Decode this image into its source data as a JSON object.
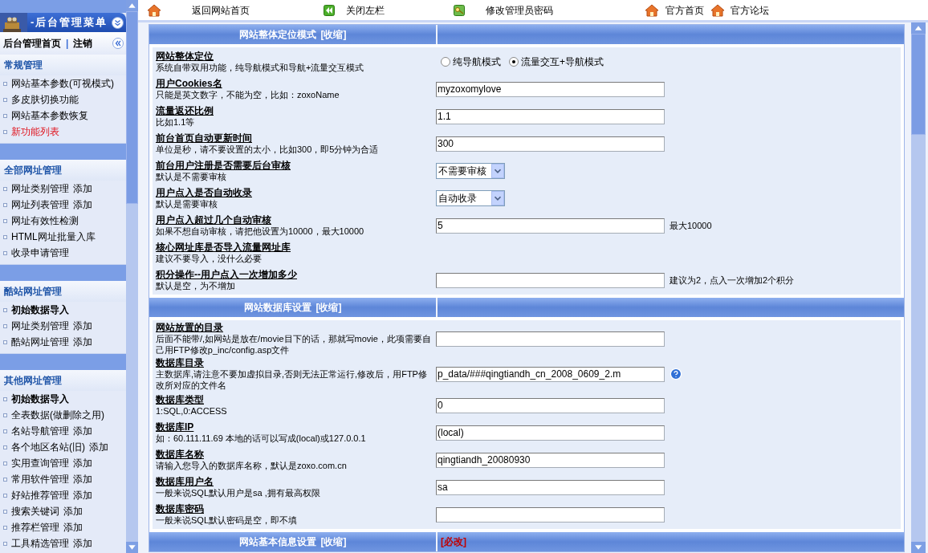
{
  "sidebar": {
    "title": "-后台管理菜单",
    "home": "后台管理首页",
    "separator": "|",
    "logout": "注销",
    "groups": [
      {
        "title": "常规管理",
        "items": [
          {
            "label": "网站基本参数(可视模式)",
            "kind": "plain"
          },
          {
            "label": "多皮肤切换功能",
            "kind": "plain"
          },
          {
            "label": "网站基本参数恢复",
            "kind": "plain"
          },
          {
            "label": "新功能列表",
            "kind": "new"
          }
        ]
      },
      {
        "title": "全部网址管理",
        "items": [
          {
            "label": "网址类别管理",
            "action": "添加",
            "kind": "plain"
          },
          {
            "label": "网址列表管理",
            "action": "添加",
            "kind": "plain"
          },
          {
            "label": "网址有效性检测",
            "kind": "plain"
          },
          {
            "label": "HTML网址批量入库",
            "kind": "plain"
          },
          {
            "label": "收录申请管理",
            "kind": "plain"
          }
        ]
      },
      {
        "title": "酷站网址管理",
        "items": [
          {
            "label": "初始数据导入",
            "kind": "bold"
          },
          {
            "label": "网址类别管理",
            "action": "添加",
            "kind": "plain"
          },
          {
            "label": "酷站网址管理",
            "action": "添加",
            "kind": "plain"
          }
        ]
      },
      {
        "title": "其他网址管理",
        "items": [
          {
            "label": "初始数据导入",
            "kind": "bold"
          },
          {
            "label": "全表数据(做删除之用)",
            "kind": "plain"
          },
          {
            "label": "名站导航管理",
            "action": "添加",
            "kind": "plain"
          },
          {
            "label": "各个地区名站(旧)",
            "action": "添加",
            "kind": "plain"
          },
          {
            "label": "实用查询管理",
            "action": "添加",
            "kind": "plain"
          },
          {
            "label": "常用软件管理",
            "action": "添加",
            "kind": "plain"
          },
          {
            "label": "好站推荐管理",
            "action": "添加",
            "kind": "plain"
          },
          {
            "label": "搜索关键词",
            "action": "添加",
            "kind": "plain"
          },
          {
            "label": "推荐栏管理",
            "action": "添加",
            "kind": "plain"
          },
          {
            "label": "工具精选管理",
            "action": "添加",
            "kind": "plain"
          }
        ]
      }
    ]
  },
  "toolbar": [
    {
      "label": "返回网站首页",
      "kind": "house"
    },
    {
      "label": "关闭左栏",
      "kind": "back"
    },
    {
      "label": "修改管理员密码",
      "kind": "key"
    },
    {
      "label": "官方首页",
      "kind": "house"
    },
    {
      "label": "官方论坛",
      "kind": "house"
    }
  ],
  "sections": [
    {
      "title": "网站整体定位模式",
      "action": "[收缩]",
      "rows": [
        {
          "label": "网站整体定位",
          "desc": "系统自带双用功能，纯导航模式和导航+流量交互模式",
          "kind": "radio",
          "options": [
            {
              "label": "纯导航模式",
              "selected": false
            },
            {
              "label": "流量交互+导航模式",
              "selected": true
            }
          ]
        },
        {
          "label": "用户Cookies名",
          "desc": "只能是英文数字，不能为空，比如：zoxoName",
          "kind": "text",
          "value": "myzoxomylove"
        },
        {
          "label": "流量返还比例",
          "desc": "比如1.1等",
          "kind": "text",
          "value": "1.1"
        },
        {
          "label": "前台首页自动更新时间",
          "desc": "单位是秒，请不要设置的太小，比如300，即5分钟为合适",
          "kind": "text",
          "value": "300"
        },
        {
          "label": "前台用户注册是否需要后台审核",
          "desc": "默认是不需要审核",
          "kind": "select",
          "value": "不需要审核"
        },
        {
          "label": "用户点入是否自动收录",
          "desc": "默认是需要审核",
          "kind": "select",
          "value": "自动收录"
        },
        {
          "label": "用户点入超过几个自动审核",
          "desc": "如果不想自动审核，请把他设置为10000，最大10000",
          "kind": "text",
          "value": "5",
          "note": "最大10000"
        },
        {
          "label": "核心网址库是否导入流量网址库",
          "desc": "建议不要导入，没什么必要",
          "kind": "blank"
        },
        {
          "label": "积分操作--用户点入一次增加多少",
          "desc": "默认是空，为不增加",
          "kind": "text",
          "note": "建议为2，点入一次增加2个积分"
        }
      ]
    },
    {
      "title": "网站数据库设置",
      "action": "[收缩]",
      "rows": [
        {
          "label": "网站放置的目录",
          "desc": "后面不能带/,如网站是放在/movie目下的话，那就写movie，此项需要自己用FTP修改p_inc/config.asp文件",
          "kind": "text"
        },
        {
          "label": "数据库目录",
          "desc": "主数据库,请注意不要加虚拟目录,否则无法正常运行,修改后，用FTP修改所对应的文件名",
          "kind": "text",
          "value": "p_data/###qingtiandh_cn_2008_0609_2.m",
          "help": true
        },
        {
          "label": "数据库类型",
          "desc": "1:SQL,0:ACCESS",
          "kind": "text",
          "value": "0"
        },
        {
          "label": "数据库IP",
          "desc": "如：60.111.11.69 本地的话可以写成(local)或127.0.0.1",
          "kind": "text",
          "value": "(local)"
        },
        {
          "label": "数据库名称",
          "desc": "请输入您导入的数据库名称，默认是zoxo.com.cn",
          "kind": "text",
          "value": "qingtiandh_20080930"
        },
        {
          "label": "数据库用户名",
          "desc": "一般来说SQL默认用户是sa ,拥有最高权限",
          "kind": "text",
          "value": "sa"
        },
        {
          "label": "数据库密码",
          "desc": "一般来说SQL默认密码是空，即不填",
          "kind": "text"
        }
      ]
    },
    {
      "title": "网站基本信息设置",
      "action": "[收缩]",
      "flag": "[必改]"
    }
  ]
}
